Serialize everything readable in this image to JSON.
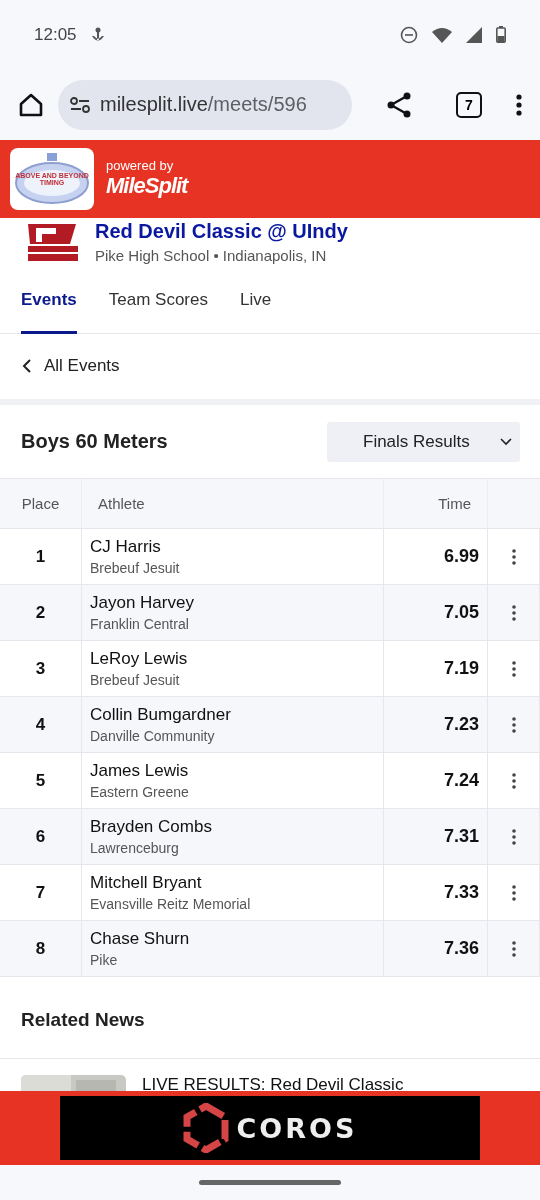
{
  "status_bar": {
    "time": "12:05"
  },
  "browser": {
    "url_host": "milesplit.live",
    "url_path": "/meets/596",
    "tab_count": "7"
  },
  "header": {
    "logo_top": "ABOVE AND BEYOND",
    "logo_bottom": "TIMING",
    "powered_by": "powered by",
    "brand": "MileSplit"
  },
  "meet": {
    "title": "Red Devil Classic @ UIndy",
    "subtitle": "Pike High School • Indianapolis, IN"
  },
  "tabs": [
    {
      "label": "Events",
      "selected": true
    },
    {
      "label": "Team Scores",
      "selected": false
    },
    {
      "label": "Live",
      "selected": false
    }
  ],
  "back_link": "All Events",
  "event": {
    "title": "Boys 60 Meters",
    "round_select": "Finals Results"
  },
  "table": {
    "columns": [
      "Place",
      "Athlete",
      "Time"
    ],
    "rows": [
      {
        "place": "1",
        "name": "CJ Harris",
        "team": "Brebeuf Jesuit",
        "time": "6.99"
      },
      {
        "place": "2",
        "name": "Jayon Harvey",
        "team": "Franklin Central",
        "time": "7.05"
      },
      {
        "place": "3",
        "name": "LeRoy Lewis",
        "team": "Brebeuf Jesuit",
        "time": "7.19"
      },
      {
        "place": "4",
        "name": "Collin Bumgardner",
        "team": "Danville Community",
        "time": "7.23"
      },
      {
        "place": "5",
        "name": "James Lewis",
        "team": "Eastern Greene",
        "time": "7.24"
      },
      {
        "place": "6",
        "name": "Brayden Combs",
        "team": "Lawrenceburg",
        "time": "7.31"
      },
      {
        "place": "7",
        "name": "Mitchell Bryant",
        "team": "Evansville Reitz Memorial",
        "time": "7.33"
      },
      {
        "place": "8",
        "name": "Chase Shurn",
        "team": "Pike",
        "time": "7.36"
      }
    ]
  },
  "related_news": {
    "title": "Related News",
    "items": [
      {
        "kind": "picture",
        "headline": "LIVE RESULTS: Red Devil Classic"
      }
    ]
  },
  "ad": {
    "brand": "COROS"
  }
}
